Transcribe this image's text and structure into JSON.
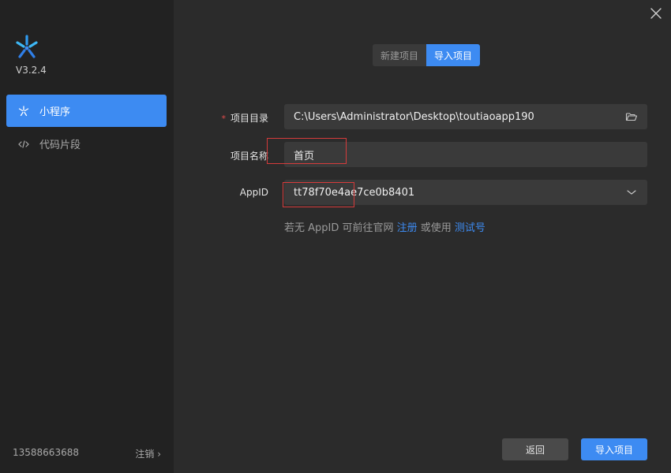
{
  "app": {
    "version": "V3.2.4",
    "brand_color": "#3d8bf2"
  },
  "sidebar": {
    "items": [
      {
        "label": "小程序",
        "icon": "asterisk-icon",
        "active": true
      },
      {
        "label": "代码片段",
        "icon": "code-icon",
        "active": false
      }
    ],
    "phone": "13588663688",
    "logout_label": "注销 ›"
  },
  "tabs": [
    {
      "label": "新建项目",
      "active": false
    },
    {
      "label": "导入项目",
      "active": true
    }
  ],
  "form": {
    "directory": {
      "label": "项目目录",
      "required_mark": "*",
      "value": "C:\\Users\\Administrator\\Desktop\\toutiaoapp190",
      "icon": "folder-open-icon"
    },
    "name": {
      "label": "项目名称",
      "value": "首页"
    },
    "appid": {
      "label": "AppID",
      "value": "tt78f70e4ae7ce0b8401",
      "icon": "chevron-down-icon"
    }
  },
  "hint": {
    "prefix": "若无 AppID 可前往官网 ",
    "register_link": "注册",
    "middle": " 或使用 ",
    "test_link": "测试号"
  },
  "buttons": {
    "back_label": "返回",
    "import_label": "导入项目"
  }
}
